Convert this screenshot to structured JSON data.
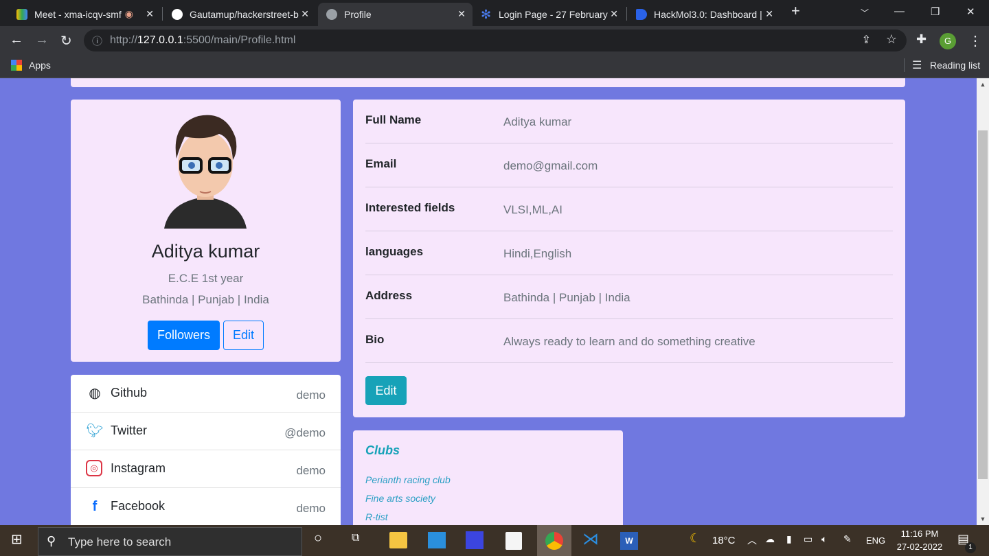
{
  "browser": {
    "tabs": [
      {
        "title": "Meet - xma-icqv-smf",
        "icon": "google-meet-icon",
        "active": false
      },
      {
        "title": "Gautamup/hackerstreet-b",
        "icon": "github-icon",
        "active": false
      },
      {
        "title": "Profile",
        "icon": "globe-icon",
        "active": true
      },
      {
        "title": "Login Page - 27 February",
        "icon": "asterisk-icon",
        "active": false
      },
      {
        "title": "HackMol3.0: Dashboard |",
        "icon": "dashboard-icon",
        "active": false
      }
    ],
    "url_prefix": "http://",
    "url_host": "127.0.0.1",
    "url_rest": ":5500/main/Profile.html",
    "profile_initial": "G",
    "bookmarks_apps": "Apps",
    "reading_list": "Reading list"
  },
  "profile": {
    "name": "Aditya kumar",
    "course": "E.C.E 1st year",
    "location": "Bathinda | Punjab | India",
    "followers_label": "Followers",
    "edit_label": "Edit"
  },
  "social": [
    {
      "name": "Github",
      "handle": "demo",
      "icon": "github-icon",
      "color": "#212529"
    },
    {
      "name": "Twitter",
      "handle": "@demo",
      "icon": "twitter-icon",
      "color": "#1da1f2"
    },
    {
      "name": "Instagram",
      "handle": "demo",
      "icon": "instagram-icon",
      "color": "#dc3545"
    },
    {
      "name": "Facebook",
      "handle": "demo",
      "icon": "facebook-icon",
      "color": "#0d6efd"
    }
  ],
  "details": {
    "rows": [
      {
        "label": "Full Name",
        "value": "Aditya kumar"
      },
      {
        "label": "Email",
        "value": "demo@gmail.com"
      },
      {
        "label": "Interested fields",
        "value": "VLSI,ML,AI"
      },
      {
        "label": "languages",
        "value": "Hindi,English"
      },
      {
        "label": "Address",
        "value": "Bathinda | Punjab | India"
      },
      {
        "label": "Bio",
        "value": "Always ready to learn and do something creative"
      }
    ],
    "edit_label": "Edit"
  },
  "clubs": {
    "title": "Clubs",
    "items": [
      "Perianth racing club",
      "Fine arts society",
      "R-tist"
    ]
  },
  "taskbar": {
    "search_placeholder": "Type here to search",
    "weather": "18°C",
    "lang": "ENG",
    "time": "11:16 PM",
    "date": "27-02-2022",
    "notifications": "1"
  },
  "colors": {
    "page_bg": "#7078e0",
    "card_bg": "#f7e6fc",
    "primary": "#007bff",
    "info": "#17a2b8"
  }
}
